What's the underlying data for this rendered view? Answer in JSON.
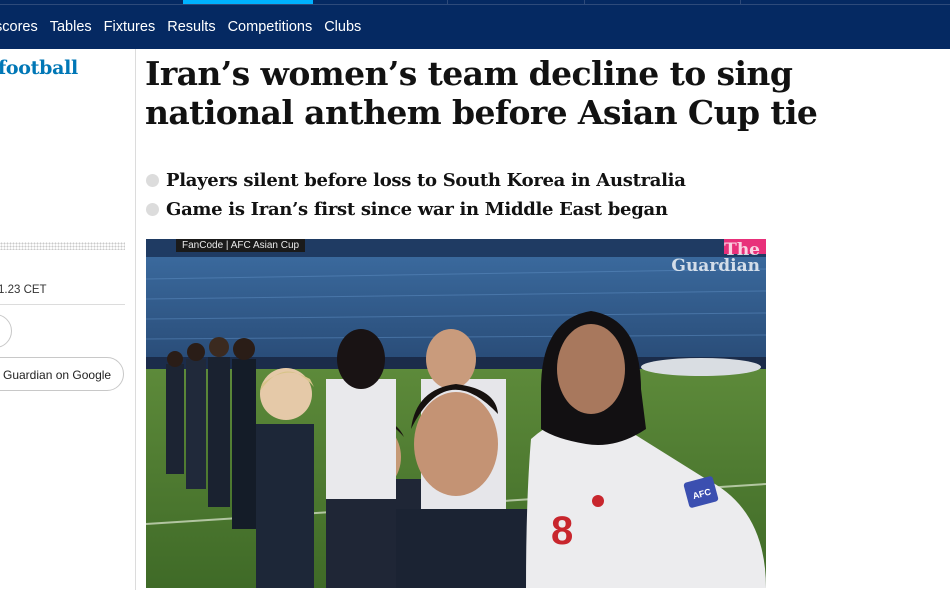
{
  "nav": {
    "items": [
      "scores",
      "Tables",
      "Fixtures",
      "Results",
      "Competitions",
      "Clubs"
    ]
  },
  "sidebar": {
    "section": "football",
    "timestamp": "1.23 CET",
    "google_button": "Guardian on Google"
  },
  "article": {
    "headline": "Iran’s women’s team decline to sing national anthem before Asian Cup tie",
    "bullets": [
      "Players silent before loss to South Korea in Australia",
      "Game is Iran’s first since war in Middle East began"
    ]
  },
  "media": {
    "broadcast_label": "FanCode | AFC Asian Cup",
    "watermark_line1": "The",
    "watermark_line2": "Guardian",
    "shirt_number": "8",
    "sleeve_badge": "AFC"
  },
  "colors": {
    "nav_bg": "#052962",
    "nav_active": "#00b2ff",
    "section_blue": "#0077b6",
    "bullet_grey": "#dcdcdc"
  }
}
